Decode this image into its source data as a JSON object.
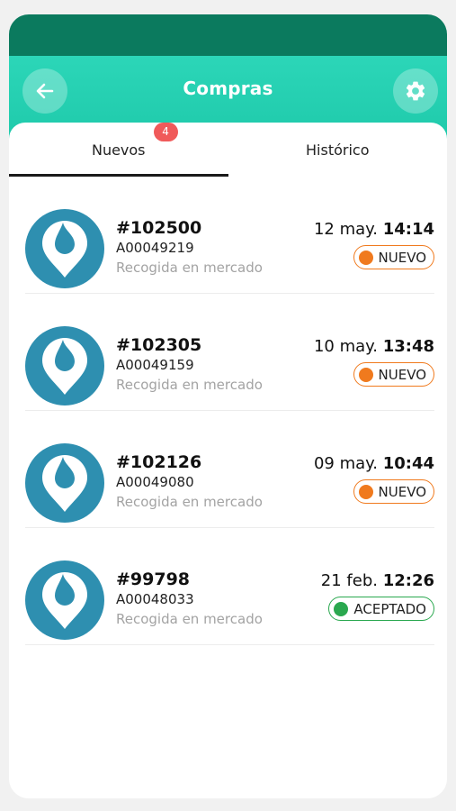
{
  "header": {
    "title": "Compras",
    "back_icon": "arrow-left-icon",
    "settings_icon": "gear-icon"
  },
  "colors": {
    "header": "#1ec9aa",
    "statusbar": "#0b7a5e",
    "nuevo": "#f07a1e",
    "aceptado": "#2aa84f",
    "badge": "#f05a5a",
    "avatar": "#2e8fb0"
  },
  "tabs": [
    {
      "label": "Nuevos",
      "badge": "4",
      "active": true
    },
    {
      "label": "Histórico",
      "active": false
    }
  ],
  "orders": [
    {
      "number": "#102500",
      "code": "A00049219",
      "type": "Recogida en mercado",
      "date_day": "12 may.",
      "date_time": "14:14",
      "status": "NUEVO",
      "status_kind": "nuevo"
    },
    {
      "number": "#102305",
      "code": "A00049159",
      "type": "Recogida en mercado",
      "date_day": "10 may.",
      "date_time": "13:48",
      "status": "NUEVO",
      "status_kind": "nuevo"
    },
    {
      "number": "#102126",
      "code": "A00049080",
      "type": "Recogida en mercado",
      "date_day": "09 may.",
      "date_time": "10:44",
      "status": "NUEVO",
      "status_kind": "nuevo"
    },
    {
      "number": "#99798",
      "code": "A00048033",
      "type": "Recogida en mercado",
      "date_day": "21 feb.",
      "date_time": "12:26",
      "status": "ACEPTADO",
      "status_kind": "aceptado"
    }
  ]
}
